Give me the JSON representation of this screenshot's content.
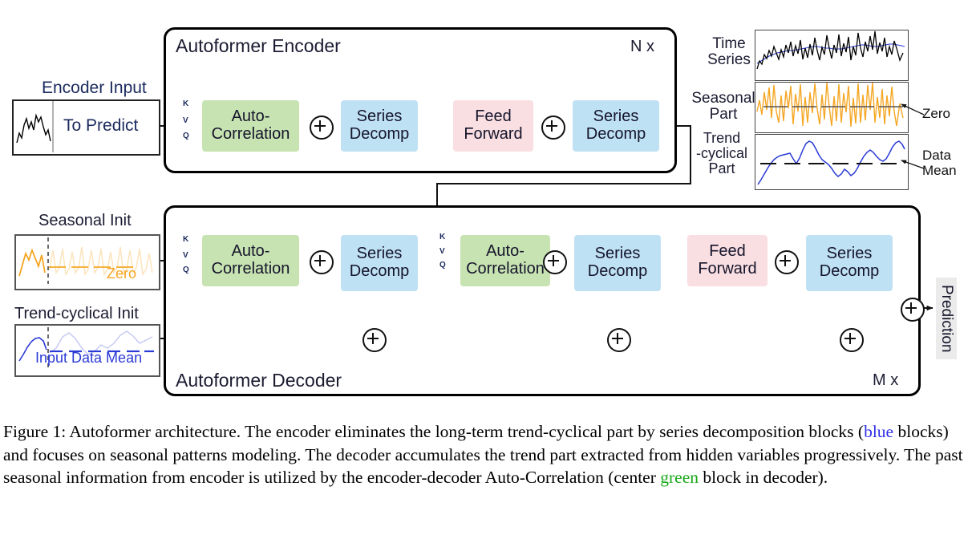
{
  "figure": {
    "caption_prefix": "Figure 1: Autoformer architecture. The encoder eliminates the long-term trend-cyclical part by series decomposition blocks (",
    "caption_blue_word": "blue",
    "caption_mid": " blocks) and focuses on seasonal patterns modeling. The decoder accumulates the trend part extracted from hidden variables progressively. The past seasonal information from encoder is utilized by the encoder-decoder Auto-Correlation (center ",
    "caption_green_word": "green",
    "caption_suffix": " block in decoder)."
  },
  "colors": {
    "auto_correlation_green": "#c8e3b2",
    "series_decomp_blue": "#bfe1f4",
    "feed_forward_pink": "#f9dee2",
    "seasonal_orange": "#f5a623",
    "trend_blue": "#2a3ad6",
    "time_series_black": "#000000",
    "prediction_badge_grey": "#ebebeb",
    "kvq_navy": "#1b2a5e"
  },
  "encoder": {
    "title": "Autoformer Encoder",
    "repeat_label": "N x",
    "input_caption": "Encoder Input",
    "input_to_predict": "To Predict",
    "kvq": [
      "K",
      "V",
      "Q"
    ],
    "blocks": [
      {
        "label_line1": "Auto-",
        "label_line2": "Correlation",
        "color": "green"
      },
      {
        "label_line1": "Series",
        "label_line2": "Decomp",
        "color": "blue"
      },
      {
        "label_line1": "Feed",
        "label_line2": "Forward",
        "color": "pink"
      },
      {
        "label_line1": "Series",
        "label_line2": "Decomp",
        "color": "blue"
      }
    ]
  },
  "decoder": {
    "title": "Autoformer Decoder",
    "repeat_label": "M x",
    "seasonal_init_caption": "Seasonal Init",
    "seasonal_init_inline": "Zero",
    "trend_init_caption": "Trend-cyclical Init",
    "trend_init_inline": "Input Data Mean",
    "kvq_first": [
      "K",
      "V",
      "Q"
    ],
    "kvq_second": [
      "K",
      "V",
      "Q"
    ],
    "blocks": [
      {
        "label_line1": "Auto-",
        "label_line2": "Correlation",
        "color": "green"
      },
      {
        "label_line1": "Series",
        "label_line2": "Decomp",
        "color": "blue"
      },
      {
        "label_line1": "Auto-",
        "label_line2": "Correlation",
        "color": "green"
      },
      {
        "label_line1": "Series",
        "label_line2": "Decomp",
        "color": "blue"
      },
      {
        "label_line1": "Feed",
        "label_line2": "Forward",
        "color": "pink"
      },
      {
        "label_line1": "Series",
        "label_line2": "Decomp",
        "color": "blue"
      }
    ],
    "output_label": "Prediction"
  },
  "decomposition_panel": {
    "rows": [
      {
        "label_line1": "Time",
        "label_line2": "Series",
        "label_line3": "",
        "annotation": ""
      },
      {
        "label_line1": "Seasonal",
        "label_line2": "Part",
        "label_line3": "",
        "annotation": "Zero"
      },
      {
        "label_line1": "Trend",
        "label_line2": "-cyclical",
        "label_line3": "Part",
        "annotation_line1": "Data",
        "annotation_line2": "Mean"
      }
    ]
  },
  "chart_data": {
    "type": "line",
    "title": "Series decomposition illustration",
    "panels": [
      {
        "name": "Time Series",
        "series": [
          {
            "name": "raw",
            "color": "#000000",
            "values": [
              20,
              38,
              30,
              52,
              44,
              62,
              50,
              70,
              58,
              46,
              64,
              52,
              72,
              60,
              78,
              56,
              74,
              62,
              80,
              48,
              68,
              54,
              76,
              58,
              84,
              66,
              52,
              70,
              60,
              88,
              68,
              56,
              74,
              62,
              90,
              58,
              76,
              64,
              86,
              54,
              72,
              60,
              92,
              68,
              58,
              80,
              66,
              88,
              70,
              96,
              62,
              78,
              66,
              90,
              58,
              74,
              62,
              86,
              70,
              54
            ]
          },
          {
            "name": "trend",
            "color": "#2a3ad6",
            "values": [
              30,
              34,
              38,
              42,
              45,
              48,
              50,
              52,
              53,
              54,
              55,
              56,
              58,
              60,
              62,
              63,
              62,
              61,
              60,
              59,
              58,
              58,
              59,
              61,
              63,
              65,
              66,
              66,
              65,
              64,
              63,
              63,
              64,
              66,
              68,
              69,
              69,
              68,
              67,
              66,
              66,
              67,
              69,
              71,
              73,
              75,
              76,
              76,
              75,
              74,
              73,
              72,
              72,
              73,
              74,
              75,
              75,
              74,
              73,
              72
            ]
          }
        ],
        "gridline": null
      },
      {
        "name": "Seasonal Part",
        "series": [
          {
            "name": "seasonal",
            "color": "#f5a623",
            "values": [
              -8,
              14,
              -10,
              28,
              -6,
              36,
              -14,
              42,
              -8,
              -20,
              22,
              -18,
              30,
              -4,
              40,
              -22,
              26,
              -10,
              44,
              -30,
              18,
              -24,
              32,
              -14,
              48,
              -8,
              -26,
              24,
              -16,
              50,
              -6,
              -28,
              20,
              -18,
              52,
              -24,
              28,
              -12,
              46,
              -32,
              16,
              -22,
              54,
              -10,
              -26,
              30,
              -20,
              48,
              -8,
              56,
              -24,
              22,
              -16,
              44,
              -28,
              18,
              -14,
              40,
              -6,
              -30
            ]
          }
        ],
        "gridline": {
          "value": 0,
          "label": "Zero",
          "style": "solid-dash",
          "color": "#444444"
        }
      },
      {
        "name": "Trend-cyclical Part",
        "series": [
          {
            "name": "trend",
            "color": "#2a3ad6",
            "values": [
              2,
              8,
              16,
              26,
              36,
              44,
              50,
              54,
              56,
              57,
              58,
              60,
              48,
              40,
              52,
              68,
              80,
              86,
              84,
              76,
              66,
              58,
              54,
              50,
              44,
              36,
              30,
              34,
              42,
              38,
              32,
              36,
              46,
              58,
              70,
              78,
              82,
              78,
              72,
              68,
              66,
              70,
              78,
              86,
              92,
              94,
              90,
              82,
              74,
              70,
              72,
              76,
              80,
              82,
              80,
              76,
              74,
              76,
              78,
              78
            ]
          }
        ],
        "gridline": {
          "value": 55,
          "label": "Data Mean",
          "style": "dashed",
          "color": "#111111"
        }
      }
    ]
  },
  "mini_plots": {
    "encoder_input": {
      "name": "encoder-input-series",
      "color": "#000000"
    },
    "seasonal_init": {
      "name": "seasonal-init-series",
      "color": "#f5a623",
      "faded": true
    },
    "trend_init": {
      "name": "trend-init-series",
      "color": "#2a3ad6",
      "faded": true
    }
  }
}
